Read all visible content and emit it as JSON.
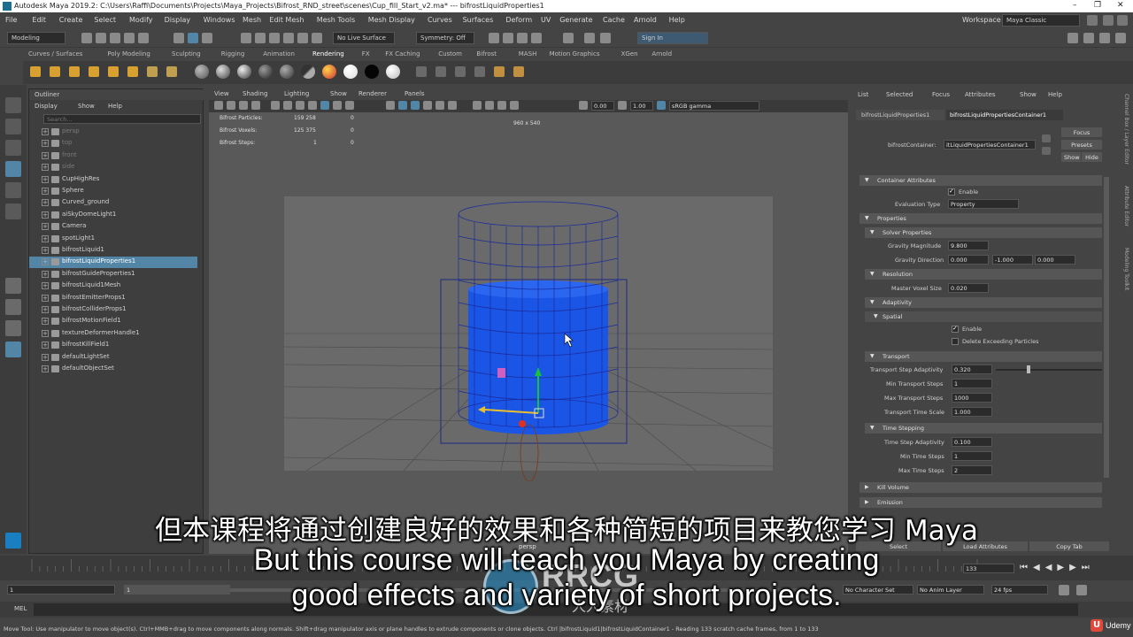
{
  "titlebar": {
    "title": "Autodesk Maya 2019.2: C:\\Users\\Raffi\\Documents\\Projects\\Maya_Projects\\Bifrost_RND_street\\scenes\\Cup_fill_Start_v2.ma*   ---   bifrostLiquidProperties1"
  },
  "menubar": {
    "items": [
      "File",
      "Edit",
      "Create",
      "Select",
      "Modify",
      "Display",
      "Windows",
      "Mesh",
      "Edit Mesh",
      "Mesh Tools",
      "Mesh Display",
      "Curves",
      "Surfaces",
      "Deform",
      "UV",
      "Generate",
      "Cache",
      "Arnold",
      "Help"
    ],
    "workspace_label": "Workspace :",
    "workspace_value": "Maya Classic"
  },
  "statusline": {
    "mode": "Modeling",
    "live_surface": "No Live Surface",
    "symmetry": "Symmetry: Off",
    "sign_in": "Sign In"
  },
  "shelf": {
    "tabs": [
      "Curves / Surfaces",
      "Poly Modeling",
      "Sculpting",
      "Rigging",
      "Animation",
      "Rendering",
      "FX",
      "FX Caching",
      "Custom",
      "Bifrost",
      "MASH",
      "Motion Graphics",
      "XGen",
      "Arnold"
    ],
    "active_tab": "Rendering"
  },
  "outliner": {
    "title": "Outliner",
    "menu": [
      "Display",
      "Show",
      "Help"
    ],
    "search_placeholder": "Search...",
    "items": [
      {
        "label": "persp",
        "dim": true
      },
      {
        "label": "top",
        "dim": true
      },
      {
        "label": "front",
        "dim": true
      },
      {
        "label": "side",
        "dim": true
      },
      {
        "label": "CupHighRes"
      },
      {
        "label": "Sphere"
      },
      {
        "label": "Curved_ground"
      },
      {
        "label": "aiSkyDomeLight1"
      },
      {
        "label": "Camera"
      },
      {
        "label": "spotLight1"
      },
      {
        "label": "bifrostLiquid1"
      },
      {
        "label": "bifrostLiquidProperties1",
        "selected": true
      },
      {
        "label": "bifrostGuideProperties1"
      },
      {
        "label": "bifrostLiquid1Mesh"
      },
      {
        "label": "bifrostEmitterProps1"
      },
      {
        "label": "bifrostColliderProps1"
      },
      {
        "label": "bifrostMotionField1"
      },
      {
        "label": "textureDeformerHandle1"
      },
      {
        "label": "bifrostKillField1"
      },
      {
        "label": "defaultLightSet"
      },
      {
        "label": "defaultObjectSet"
      }
    ]
  },
  "viewport": {
    "menu": [
      "View",
      "Shading",
      "Lighting",
      "Show",
      "Renderer",
      "Panels"
    ],
    "exposure": "0.00",
    "gamma": "1.00",
    "color_space": "sRGB gamma",
    "resolution": "960 x 540",
    "hud": [
      {
        "label": "Bifrost Particles:",
        "a": "159 258",
        "b": "0"
      },
      {
        "label": "Bifrost Voxels:",
        "a": "125 375",
        "b": "0"
      },
      {
        "label": "Bifrost Steps:",
        "a": "1",
        "b": "0"
      }
    ],
    "camera_name": "persp"
  },
  "attribute_editor": {
    "menu": [
      "List",
      "Selected",
      "Focus",
      "Attributes",
      "Show",
      "Help"
    ],
    "tabs": [
      "bifrostLiquidProperties1",
      "bifrostLiquidPropertiesContainer1"
    ],
    "node_label": "bifrostContainer:",
    "node_value": "itLiquidPropertiesContainer1",
    "focus": "Focus",
    "presets": "Presets",
    "show": "Show",
    "hide": "Hide",
    "sections": {
      "container_attributes": "Container Attributes",
      "enable": "Enable",
      "evaluation_type_label": "Evaluation Type",
      "evaluation_type_value": "Property",
      "properties": "Properties",
      "solver_properties": "Solver Properties",
      "gravity_magnitude_label": "Gravity Magnitude",
      "gravity_magnitude": "9.800",
      "gravity_direction_label": "Gravity Direction",
      "gravity_direction": [
        "0.000",
        "-1.000",
        "0.000"
      ],
      "resolution": "Resolution",
      "master_voxel_size_label": "Master Voxel Size",
      "master_voxel_size": "0.020",
      "adaptivity": "Adaptivity",
      "spatial": "Spatial",
      "spatial_enable": "Enable",
      "delete_exceeding": "Delete Exceeding Particles",
      "transport": "Transport",
      "transport_step_adaptivity_label": "Transport Step Adaptivity",
      "transport_step_adaptivity": "0.320",
      "min_transport_steps_label": "Min Transport Steps",
      "min_transport_steps": "1",
      "max_transport_steps_label": "Max Transport Steps",
      "max_transport_steps": "1000",
      "transport_time_scale_label": "Transport Time Scale",
      "transport_time_scale": "1.000",
      "time_stepping": "Time Stepping",
      "time_step_adaptivity_label": "Time Step Adaptivity",
      "time_step_adaptivity": "0.100",
      "min_time_steps_label": "Min Time Steps",
      "min_time_steps": "1",
      "max_time_steps_label": "Max Time Steps",
      "max_time_steps": "2",
      "kill_volume": "Kill Volume",
      "emission": "Emission"
    },
    "bottom_buttons": [
      "Select",
      "Load Attributes",
      "Copy Tab"
    ]
  },
  "side_strip": [
    "Channel Box / Layer Editor",
    "Attribute Editor",
    "Modeling Toolkit"
  ],
  "timeline": {
    "current_frame": "133",
    "start": "1",
    "range_start": "1",
    "character_set": "No Character Set",
    "anim_layer": "No Anim Layer",
    "fps": "24 fps"
  },
  "mel": {
    "label": "MEL"
  },
  "help_line": "Move Tool: Use manipulator to move object(s). Ctrl+MMB+drag to move components along normals. Shift+drag manipulator axis or plane handles to extrude components or clone objects. Ctrl  |bifrostLiquid1|bifrostLiquidContainer1 - Reading 133 scratch cache frames, from 1 to 133",
  "subtitles": {
    "cn": "但本课程将通过创建良好的效果和各种简短的项目来教您学习 Maya",
    "en1": "But this course will teach you Maya by creating",
    "en2": "good effects and variety of short projects."
  },
  "watermark": {
    "letters": "RRCG",
    "cn": "人人素材"
  },
  "udemy": "Udemy"
}
